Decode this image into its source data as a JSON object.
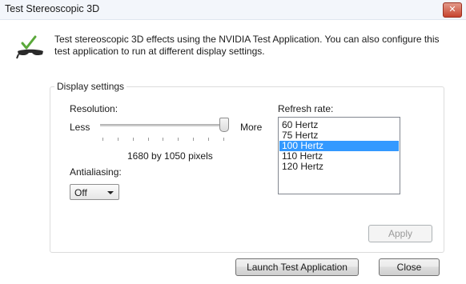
{
  "window": {
    "title": "Test Stereoscopic 3D",
    "close_glyph": "✕"
  },
  "description": "Test stereoscopic 3D effects using the NVIDIA Test Application. You can also configure this test application to run at different display settings.",
  "display_settings": {
    "label": "Display settings",
    "resolution": {
      "label": "Resolution:",
      "less_label": "Less",
      "more_label": "More",
      "value_text": "1680 by 1050 pixels",
      "slider_position": 1.0
    },
    "antialiasing": {
      "label": "Antialiasing:",
      "selected": "Off"
    },
    "refresh_rate": {
      "label": "Refresh rate:",
      "options": [
        "60 Hertz",
        "75 Hertz",
        "100 Hertz",
        "110 Hertz",
        "120 Hertz"
      ],
      "selected_index": 2
    },
    "apply_label": "Apply"
  },
  "buttons": {
    "launch_label": "Launch Test Application",
    "close_label": "Close"
  },
  "icons": {
    "header": "stereo-glasses-check-icon"
  },
  "colors": {
    "selection": "#3399ff",
    "close_button": "#c7432d",
    "check_green": "#5aa83a"
  }
}
